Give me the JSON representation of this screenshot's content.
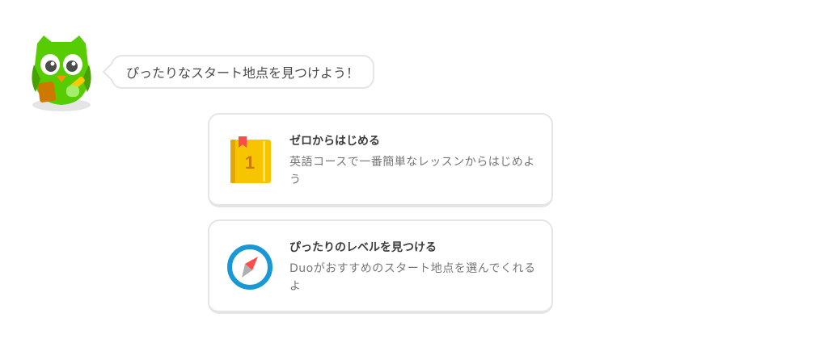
{
  "speech_bubble": {
    "text": "ぴったりなスタート地点を見つけよう！"
  },
  "options": [
    {
      "icon": "book-icon",
      "title": "ゼロからはじめる",
      "description": "英語コースで一番簡単なレッスンからはじめよう"
    },
    {
      "icon": "compass-icon",
      "title": "ぴったりのレベルを見つける",
      "description": "Duoがおすすめのスタート地点を選んでくれるよ"
    }
  ],
  "colors": {
    "mascot_green": "#58cc02",
    "book_yellow": "#f7c500",
    "compass_blue": "#1899d6",
    "compass_needle": "#ff4b4b",
    "border": "#e5e5e5"
  }
}
